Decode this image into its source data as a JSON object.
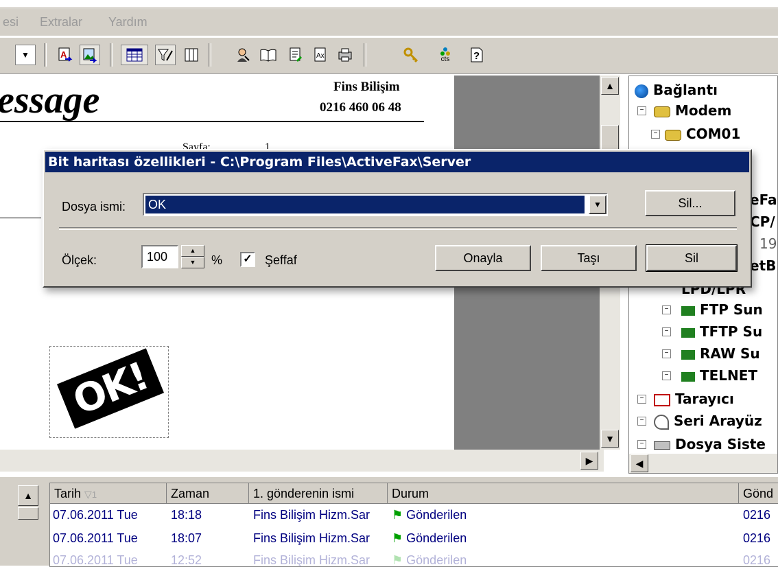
{
  "menu": {
    "items": [
      "esi",
      "Extralar",
      "Yardım"
    ]
  },
  "toolbar": {
    "icons": [
      "text-color-icon",
      "image-icon",
      "table-view-icon",
      "filter-icon",
      "columns-icon",
      "user-icon",
      "book-icon",
      "document-icon",
      "fax-icon",
      "print-icon",
      "keys-icon",
      "cts-icon",
      "help-icon"
    ],
    "cts_label": "cts"
  },
  "document": {
    "title_fragment": "essage",
    "company": "Fins Bilişim",
    "phone": "0216 460 06 48",
    "partial_line": "Sayfa:",
    "partial_value": "1",
    "stamp_text": "OK!"
  },
  "tree": {
    "root": "Bağlantı",
    "nodes": [
      "Modem",
      "COM01",
      "eFa",
      "CP/",
      "19",
      "etB",
      "LPD/LPR",
      "FTP Sun",
      "TFTP Su",
      "RAW Su",
      "TELNET",
      "Tarayıcı",
      "Seri Arayüz",
      "Dosya Siste"
    ]
  },
  "dialog": {
    "title": "Bit haritası özellikleri - C:\\Program Files\\ActiveFax\\Server",
    "file_label": "Dosya ismi:",
    "file_value": "OK",
    "browse_button": "Sil...",
    "scale_label": "Ölçek:",
    "scale_value": "100",
    "percent": "%",
    "transparent_label": "Şeffaf",
    "transparent_checked": true,
    "ok_button": "Onayla",
    "move_button": "Taşı",
    "delete_button": "Sil"
  },
  "list": {
    "columns": [
      "Tarih",
      "Zaman",
      "1. gönderenin ismi",
      "Durum",
      "Gönd"
    ],
    "sort_indicator": "1",
    "rows": [
      {
        "date": "07.06.2011 Tue",
        "time": "18:18",
        "sender": "Fins Bilişim Hizm.Sar",
        "status": "Gönderilen",
        "from": "0216"
      },
      {
        "date": "07.06.2011 Tue",
        "time": "18:07",
        "sender": "Fins Bilişim Hizm.Sar",
        "status": "Gönderilen",
        "from": "0216"
      },
      {
        "date": "07.06.2011 Tue",
        "time": "12:52",
        "sender": "Fins Bilişim Hizm.Sar",
        "status": "Gönderilen",
        "from": "0216"
      }
    ]
  },
  "colors": {
    "title_bar": "#0a246a",
    "selection": "#0a246a",
    "face": "#d4d0c8"
  }
}
